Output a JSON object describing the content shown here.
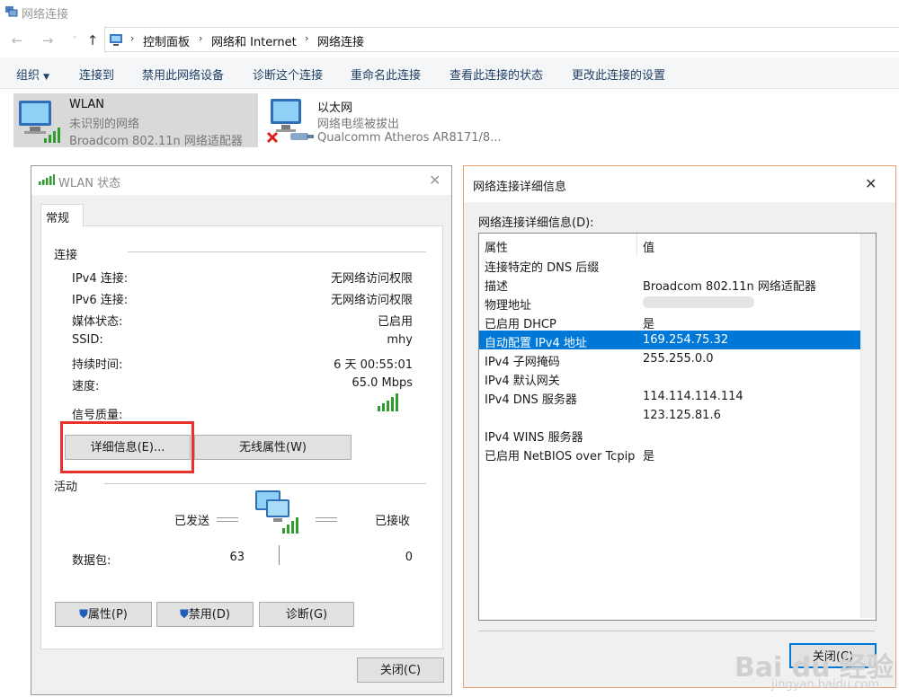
{
  "window": {
    "title": "网络连接"
  },
  "breadcrumb": [
    "控制面板",
    "网络和 Internet",
    "网络连接"
  ],
  "commands": {
    "organize": "组织",
    "connect": "连接到",
    "disable": "禁用此网络设备",
    "diagnose": "诊断这个连接",
    "rename": "重命名此连接",
    "view_status": "查看此连接的状态",
    "change_settings": "更改此连接的设置"
  },
  "adapters": [
    {
      "name": "WLAN",
      "status": "未识别的网络",
      "device": "Broadcom 802.11n 网络适配器"
    },
    {
      "name": "以太网",
      "status": "网络电缆被拔出",
      "device": "Qualcomm Atheros AR8171/8..."
    }
  ],
  "wlan_status": {
    "title": "WLAN 状态",
    "tab": "常规",
    "section_connection": "连接",
    "rows": [
      {
        "label": "IPv4 连接:",
        "value": "无网络访问权限"
      },
      {
        "label": "IPv6 连接:",
        "value": "无网络访问权限"
      },
      {
        "label": "媒体状态:",
        "value": "已启用"
      },
      {
        "label": "SSID:",
        "value": "mhy"
      },
      {
        "label": "持续时间:",
        "value": "6 天 00:55:01"
      },
      {
        "label": "速度:",
        "value": "65.0 Mbps"
      }
    ],
    "signal_label": "信号质量:",
    "details_button": "详细信息(E)...",
    "wireless_button": "无线属性(W)",
    "section_activity": "活动",
    "sent_label": "已发送",
    "received_label": "已接收",
    "packets_label": "数据包:",
    "packets_sent": "63",
    "packets_received": "0",
    "properties_button": "属性(P)",
    "disable_button": "禁用(D)",
    "diagnose_button": "诊断(G)",
    "close_button": "关闭(C)"
  },
  "details": {
    "title": "网络连接详细信息",
    "list_label": "网络连接详细信息(D):",
    "col_property": "属性",
    "col_value": "值",
    "rows": [
      {
        "property": "连接特定的 DNS 后缀",
        "value": ""
      },
      {
        "property": "描述",
        "value": "Broadcom 802.11n 网络适配器"
      },
      {
        "property": "物理地址",
        "value": ""
      },
      {
        "property": "已启用 DHCP",
        "value": "是"
      },
      {
        "property": "自动配置 IPv4 地址",
        "value": "169.254.75.32"
      },
      {
        "property": "IPv4 子网掩码",
        "value": "255.255.0.0"
      },
      {
        "property": "IPv4 默认网关",
        "value": ""
      },
      {
        "property": "IPv4 DNS 服务器",
        "value": "114.114.114.114"
      },
      {
        "property": "",
        "value": "123.125.81.6"
      },
      {
        "property": "IPv4 WINS 服务器",
        "value": ""
      },
      {
        "property": "已启用 NetBIOS over Tcpip",
        "value": "是"
      }
    ],
    "selected_row": 4,
    "close_button": "关闭(C)"
  },
  "watermark": {
    "text": "Bai du 经验",
    "url": "jingyan.baidu.com"
  },
  "colors": {
    "accent": "#0078d7",
    "highlight_box": "#e8322b",
    "signal_green": "#2e9e2e"
  }
}
